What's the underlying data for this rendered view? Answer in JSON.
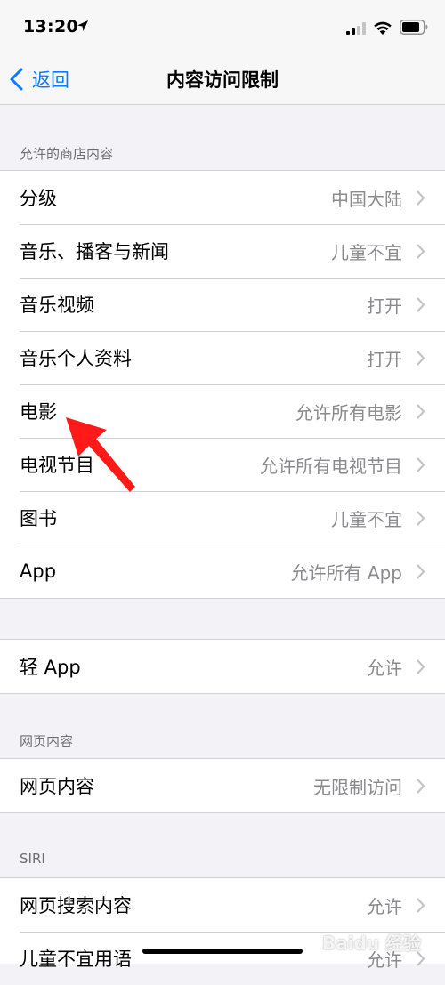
{
  "status_bar": {
    "time": "13:20"
  },
  "nav": {
    "back_label": "返回",
    "title": "内容访问限制"
  },
  "sections": {
    "store_content_header": "允许的商店内容",
    "web_content_header": "网页内容",
    "siri_header": "SIRI"
  },
  "store_rows": [
    {
      "label": "分级",
      "value": "中国大陆"
    },
    {
      "label": "音乐、播客与新闻",
      "value": "儿童不宜"
    },
    {
      "label": "音乐视频",
      "value": "打开"
    },
    {
      "label": "音乐个人资料",
      "value": "打开"
    },
    {
      "label": "电影",
      "value": "允许所有电影"
    },
    {
      "label": "电视节目",
      "value": "允许所有电视节目"
    },
    {
      "label": "图书",
      "value": "儿童不宜"
    },
    {
      "label": "App",
      "value": "允许所有 App"
    }
  ],
  "app_clips_row": {
    "label": "轻 App",
    "value": "允许"
  },
  "web_row": {
    "label": "网页内容",
    "value": "无限制访问"
  },
  "siri_rows": [
    {
      "label": "网页搜索内容",
      "value": "允许"
    },
    {
      "label": "儿童不宜用语",
      "value": "允许"
    }
  ],
  "watermark": "Baidu 经验",
  "colors": {
    "accent": "#0a7aff",
    "annotation_arrow": "#ff1a1a",
    "background": "#f2f2f7"
  }
}
